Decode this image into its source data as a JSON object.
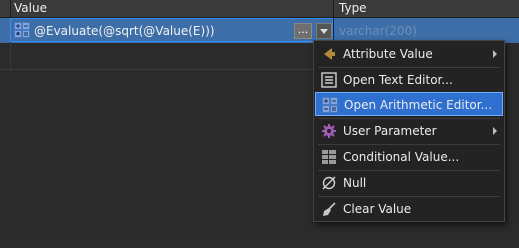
{
  "grid": {
    "columns": [
      {
        "label": "Value"
      },
      {
        "label": "Type"
      }
    ],
    "rows": [
      {
        "value": "@Evaluate(@sqrt(@Value(E)))",
        "type": "varchar(200)",
        "dots_label": "...",
        "icon": "calculator-icon"
      }
    ]
  },
  "menu": {
    "items": [
      {
        "label": "Attribute Value",
        "icon": "arrow-left-icon",
        "submenu": true,
        "active": false
      },
      {
        "label": "Open Text Editor...",
        "icon": "text-editor-icon",
        "submenu": false,
        "active": false
      },
      {
        "label": "Open Arithmetic Editor...",
        "icon": "calculator-icon",
        "submenu": false,
        "active": true
      },
      {
        "label": "User Parameter",
        "icon": "gear-icon",
        "submenu": true,
        "active": false
      },
      {
        "label": "Conditional Value...",
        "icon": "table-grid-icon",
        "submenu": false,
        "active": false
      },
      {
        "label": "Null",
        "icon": "null-icon",
        "submenu": false,
        "active": false
      },
      {
        "label": "Clear Value",
        "icon": "broom-icon",
        "submenu": false,
        "active": false
      }
    ]
  },
  "colors": {
    "selected_row": "#3d6ea8",
    "menu_highlight": "#2e6fd0",
    "menu_bg": "#232323",
    "type_text": "#6d8fb8"
  }
}
